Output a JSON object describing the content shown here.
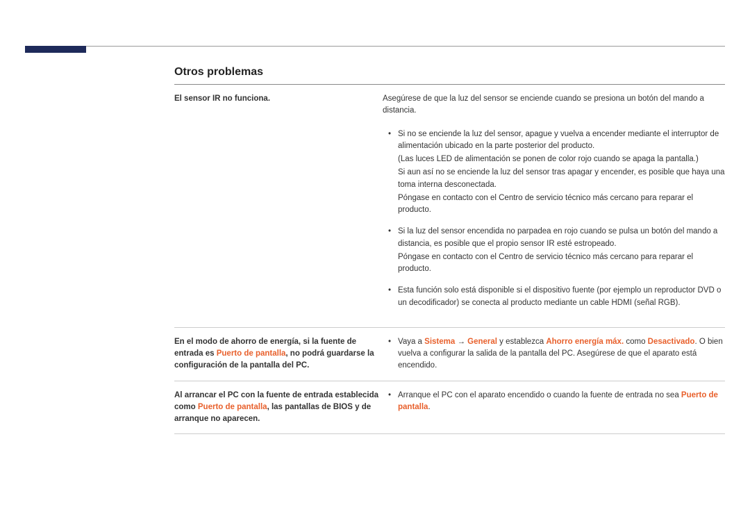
{
  "heading": "Otros problemas",
  "rows": [
    {
      "issue": [
        {
          "text": "El sensor IR no funciona.",
          "hl": false
        }
      ],
      "intro": "Asegúrese de que la luz del sensor se enciende cuando se presiona un botón del mando a distancia.",
      "bullets": [
        {
          "main": "Si no se enciende la luz del sensor, apague y vuelva a encender mediante el interruptor de alimentación ubicado en la parte posterior del producto.",
          "sub": [
            "(Las luces LED de alimentación se ponen de color rojo cuando se apaga la pantalla.)",
            "Si aun así no se enciende la luz del sensor tras apagar y encender, es posible que haya una toma interna desconectada.",
            "Póngase en contacto con el Centro de servicio técnico más cercano para reparar el producto."
          ]
        },
        {
          "main": "Si la luz del sensor encendida no parpadea en rojo cuando se pulsa un botón del mando a distancia, es posible que el propio sensor IR esté estropeado.",
          "sub": [
            "Póngase en contacto con el Centro de servicio técnico más cercano para reparar el producto."
          ]
        },
        {
          "main": "Esta función solo está disponible si el dispositivo fuente (por ejemplo un reproductor DVD o un decodificador) se conecta al producto mediante un cable HDMI (señal RGB).",
          "sub": []
        }
      ]
    },
    {
      "issue": [
        {
          "text": "En el modo de ahorro de energía, si la fuente de entrada es ",
          "hl": false
        },
        {
          "text": "Puerto de pantalla",
          "hl": true
        },
        {
          "text": ", no podrá guardarse la configuración de la pantalla del PC.",
          "hl": false
        }
      ],
      "solution_parts": [
        {
          "text": "Vaya a ",
          "hl": false
        },
        {
          "text": "Sistema",
          "hl": true
        },
        {
          "text": " → ",
          "hl": false,
          "arrow": true
        },
        {
          "text": "General",
          "hl": true
        },
        {
          "text": " y establezca ",
          "hl": false
        },
        {
          "text": "Ahorro energía máx.",
          "hl": true
        },
        {
          "text": " como ",
          "hl": false
        },
        {
          "text": "Desactivado",
          "hl": true
        },
        {
          "text": ". O bien vuelva a configurar la salida de la pantalla del PC. Asegúrese de que el aparato está encendido.",
          "hl": false
        }
      ]
    },
    {
      "issue": [
        {
          "text": "Al arrancar el PC con la fuente de entrada establecida como ",
          "hl": false
        },
        {
          "text": "Puerto de pantalla",
          "hl": true
        },
        {
          "text": ", las pantallas de BIOS y de arranque no aparecen.",
          "hl": false
        }
      ],
      "solution_parts": [
        {
          "text": "Arranque el PC con el aparato encendido o cuando la fuente de entrada no sea ",
          "hl": false
        },
        {
          "text": "Puerto de pantalla",
          "hl": true
        },
        {
          "text": ".",
          "hl": false
        }
      ]
    }
  ]
}
